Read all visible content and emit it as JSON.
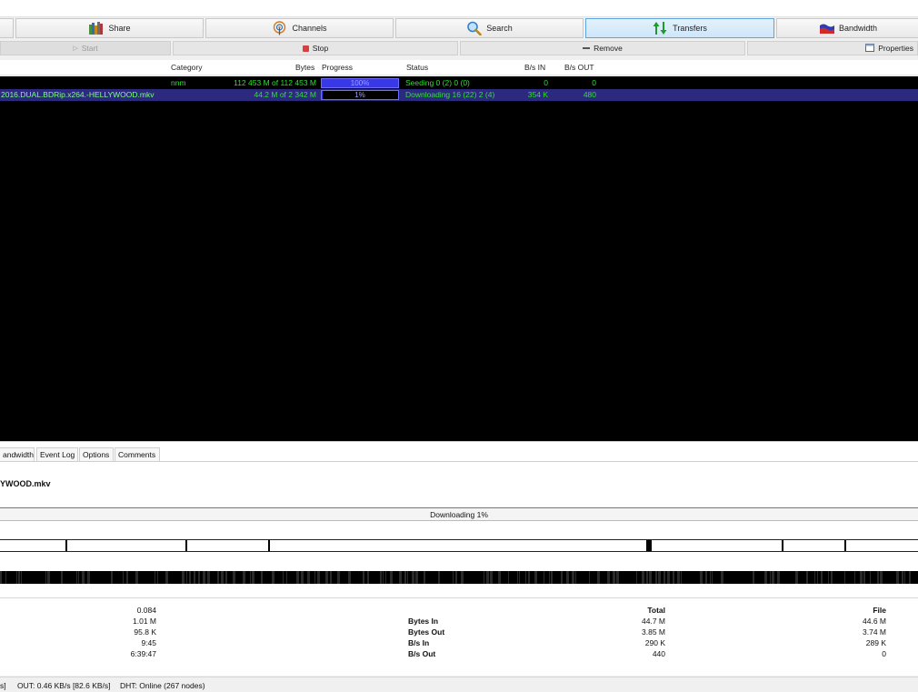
{
  "nav": {
    "tabs": [
      {
        "label": "",
        "icon": "blank"
      },
      {
        "label": "Share",
        "icon": "books-icon"
      },
      {
        "label": "Channels",
        "icon": "broadcast-icon"
      },
      {
        "label": "Search",
        "icon": "magnifier-icon"
      },
      {
        "label": "Transfers",
        "icon": "updown-arrows-icon",
        "active": true
      },
      {
        "label": "Bandwidth",
        "icon": "flag-chart-icon"
      }
    ]
  },
  "actions": {
    "start": "Start",
    "stop": "Stop",
    "remove": "Remove",
    "properties": "Properties"
  },
  "columns": {
    "category": "Category",
    "bytes": "Bytes",
    "progress": "Progress",
    "status": "Status",
    "bps_in": "B/s IN",
    "bps_out": "B/s OUT"
  },
  "transfers": [
    {
      "name": "",
      "category": "nnm",
      "bytes": "112 453 M of 112 453 M",
      "progress_label": "100%",
      "progress": 1.0,
      "status": "Seeding 0 (2) 0 (0)",
      "bps_in": "0",
      "bps_out": "0",
      "selected": false
    },
    {
      "name": "2016.DUAL.BDRip.x264.-HELLYWOOD.mkv",
      "category": "",
      "bytes": "44.2 M of 2 342 M",
      "progress_label": "1%",
      "progress": 0.01,
      "status": "Downloading 16 (22) 2 (4)",
      "bps_in": "354 K",
      "bps_out": "480",
      "selected": true
    }
  ],
  "detail": {
    "tabs": [
      "andwidth",
      "Event Log",
      "Options",
      "Comments"
    ],
    "filename": "YWOOD.mkv",
    "status_text": "Downloading 1%",
    "left_values": [
      "0.084",
      "1.01 M",
      "95.8 K",
      "9:45",
      "6:39:47"
    ],
    "labels": [
      "Bytes In",
      "Bytes Out",
      "B/s In",
      "B/s Out"
    ],
    "total_header": "Total",
    "total_values": [
      "44.7 M",
      "3.85 M",
      "290 K",
      "440"
    ],
    "file_header": "File",
    "file_values": [
      "44.6 M",
      "3.74 M",
      "289 K",
      "0"
    ]
  },
  "statusbar": {
    "in_fragment": "s]",
    "out": "OUT: 0.46 KB/s [82.6 KB/s]",
    "dht": "DHT: Online (267 nodes)"
  },
  "colors": {
    "list_bg": "#000000",
    "selected_row": "#2c2a7f",
    "text_green": "#2ee02e",
    "progress_fill": "#3838e6",
    "active_tab": "#cfe6f9"
  }
}
